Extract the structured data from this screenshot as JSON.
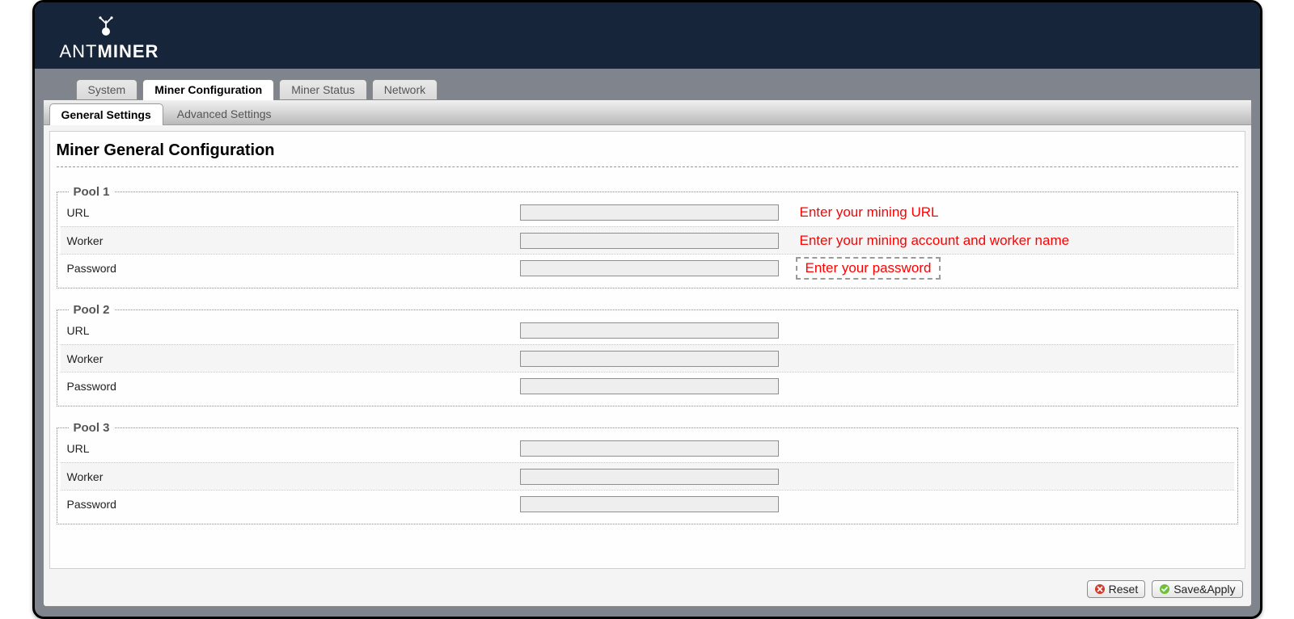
{
  "brand": {
    "thin": "ANT",
    "bold": "MINER"
  },
  "main_tabs": {
    "system": "System",
    "miner_conf": "Miner Configuration",
    "miner_status": "Miner Status",
    "network": "Network",
    "active": "miner_conf"
  },
  "sub_tabs": {
    "general": "General Settings",
    "advanced": "Advanced Settings",
    "active": "general"
  },
  "page": {
    "title": "Miner General Configuration"
  },
  "pools": [
    {
      "legend": "Pool 1",
      "url_label": "URL",
      "url_value": "",
      "url_hint": "Enter your mining URL",
      "worker_label": "Worker",
      "worker_value": "",
      "worker_hint": "Enter your mining account and worker name",
      "password_label": "Password",
      "password_value": "",
      "password_hint": "Enter your password",
      "password_hint_dashed": true
    },
    {
      "legend": "Pool 2",
      "url_label": "URL",
      "url_value": "",
      "url_hint": "",
      "worker_label": "Worker",
      "worker_value": "",
      "worker_hint": "",
      "password_label": "Password",
      "password_value": "",
      "password_hint": "",
      "password_hint_dashed": false
    },
    {
      "legend": "Pool 3",
      "url_label": "URL",
      "url_value": "",
      "url_hint": "",
      "worker_label": "Worker",
      "worker_value": "",
      "worker_hint": "",
      "password_label": "Password",
      "password_value": "",
      "password_hint": "",
      "password_hint_dashed": false
    }
  ],
  "buttons": {
    "reset": "Reset",
    "save_apply": "Save&Apply"
  }
}
